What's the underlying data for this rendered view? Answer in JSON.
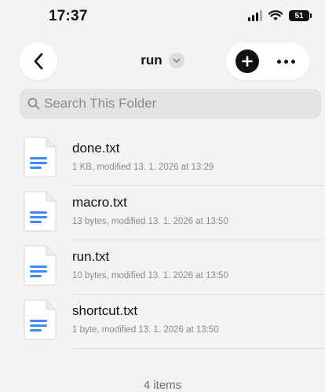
{
  "status_bar": {
    "time": "17:37",
    "battery": "51",
    "icons": [
      "signal-icon",
      "wifi-icon",
      "battery-icon"
    ]
  },
  "nav": {
    "title": "run",
    "back_icon": "chevron-left-icon",
    "title_menu_icon": "chevron-down-icon",
    "add_icon": "plus-circle-icon",
    "more_icon": "ellipsis-icon"
  },
  "search": {
    "placeholder": "Search This Folder",
    "icon": "magnifier-icon"
  },
  "files": [
    {
      "name": "done.txt",
      "meta": "1 KB, modified 13. 1. 2026 at 13:29"
    },
    {
      "name": "macro.txt",
      "meta": "13 bytes, modified 13. 1. 2026 at 13:50"
    },
    {
      "name": "run.txt",
      "meta": "10 bytes, modified 13. 1. 2026 at 13:50"
    },
    {
      "name": "shortcut.txt",
      "meta": "1 byte, modified 13. 1. 2026 at 13:50"
    }
  ],
  "footer": {
    "count": "4 items"
  },
  "colors": {
    "background": "#f3f3f4",
    "search_bg": "#e3e3e6",
    "doc_lines": "#3f8cf0",
    "secondary_text": "#8a8a8e"
  }
}
